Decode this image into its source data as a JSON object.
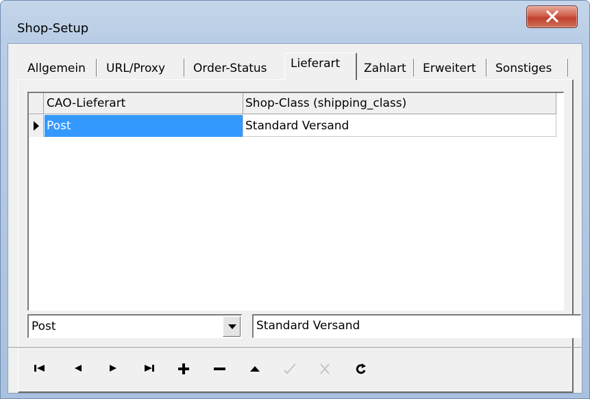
{
  "window": {
    "title": "Shop-Setup",
    "close_label": "X"
  },
  "tabs": [
    {
      "label": "Allgemein",
      "active": false
    },
    {
      "label": "URL/Proxy",
      "active": false
    },
    {
      "label": "Order-Status",
      "active": false
    },
    {
      "label": "Lieferart",
      "active": true
    },
    {
      "label": "Zahlart",
      "active": false
    },
    {
      "label": "Erweitert",
      "active": false
    },
    {
      "label": "Sonstiges",
      "active": false
    }
  ],
  "grid": {
    "columns": [
      "CAO-Lieferart",
      "Shop-Class (shipping_class)"
    ],
    "rows": [
      {
        "lieferart": "Post",
        "shop_class": "Standard Versand",
        "current": true
      }
    ]
  },
  "editors": {
    "combo_value": "Post",
    "shop_class_value": "Standard Versand"
  },
  "navigator": [
    {
      "name": "first-record",
      "icon": "first-icon",
      "enabled": true
    },
    {
      "name": "prior-record",
      "icon": "prior-icon",
      "enabled": true
    },
    {
      "name": "next-record",
      "icon": "next-icon",
      "enabled": true
    },
    {
      "name": "last-record",
      "icon": "last-icon",
      "enabled": true
    },
    {
      "name": "insert-record",
      "icon": "plus-icon",
      "enabled": true
    },
    {
      "name": "delete-record",
      "icon": "minus-icon",
      "enabled": true
    },
    {
      "name": "edit-record",
      "icon": "up-triangle-icon",
      "enabled": true
    },
    {
      "name": "post-record",
      "icon": "checkmark-icon",
      "enabled": false
    },
    {
      "name": "cancel-edit",
      "icon": "cross-icon",
      "enabled": false
    },
    {
      "name": "refresh-data",
      "icon": "refresh-icon",
      "enabled": true
    }
  ],
  "colors": {
    "selection": "#3399ff",
    "close_button": "#c0412d"
  }
}
